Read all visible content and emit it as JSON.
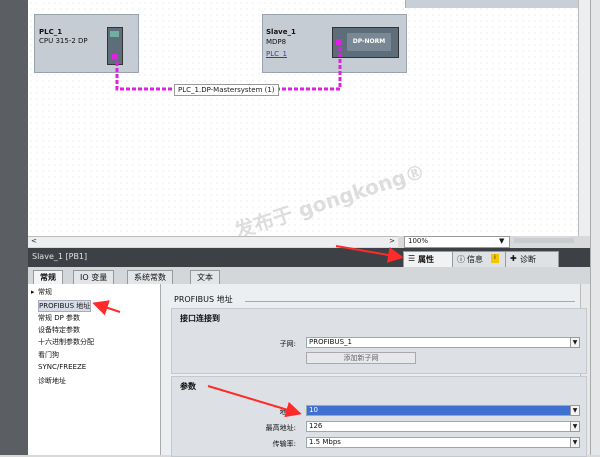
{
  "canvas": {
    "top_tab": "",
    "devices": [
      {
        "name": "PLC_1",
        "type": "CPU 315-2 DP"
      },
      {
        "name": "Slave_1",
        "type": "MDP8",
        "link": "PLC_1",
        "module_label": "DP-NORM"
      }
    ],
    "network_label": "PLC_1.DP-Mastersystem (1)",
    "zoom": "100%",
    "watermark": "发布于 gongkong®"
  },
  "inspector": {
    "title": "Slave_1 [PB1]",
    "right_tabs": {
      "properties": "属性",
      "info": "信息",
      "diagnostics": "诊断"
    },
    "tabs": [
      "常规",
      "IO 变量",
      "系统常数",
      "文本"
    ],
    "nav": [
      "常规",
      "PROFIBUS 地址",
      "常规 DP 参数",
      "设备特定参数",
      "十六进制参数分配",
      "看门狗",
      "SYNC/FREEZE",
      "诊断地址"
    ],
    "section_title": "PROFIBUS 地址",
    "interface_group": {
      "title": "接口连接到",
      "subnet_label": "子网:",
      "subnet_value": "PROFIBUS_1",
      "add_subnet_button": "添加新子网"
    },
    "params_group": {
      "title": "参数",
      "address_label": "地址:",
      "address_value": "10",
      "highest_label": "最高地址:",
      "highest_value": "126",
      "rate_label": "传输率:",
      "rate_value": "1.5 Mbps"
    }
  },
  "colors": {
    "accent": "#ff2a2a",
    "network": "#e020e0",
    "selection": "#3f6fd1"
  }
}
